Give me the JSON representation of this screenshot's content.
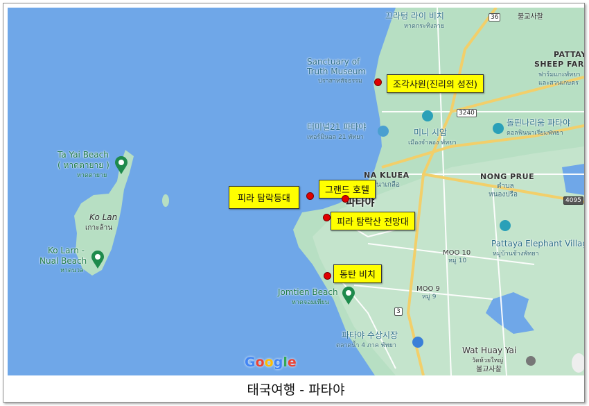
{
  "caption": "태국여행  -  파타야",
  "map": {
    "places": {
      "kradang_beach": "끄라텅 라이 비치",
      "kradang_beach_th": "หาดกระทิงลาย",
      "temple_top": "불교사찰",
      "sanctuary_l1": "Sanctuary of",
      "sanctuary_l2": "Truth Museum",
      "sanctuary_th": "ปราสาทสัจธรรม",
      "pattaya_sheep_l1": "PATTAYA",
      "pattaya_sheep_l2": "SHEEP FARM",
      "pattaya_sheep_th1": "ฟาร์มแกะพัทยา",
      "pattaya_sheep_th2": "และสวนเกษตร",
      "terminal21": "터미널21 파타야",
      "terminal21_th": "เทอร์มินอล 21 พัทยา",
      "mini_siam": "미니 시암",
      "mini_siam_th": "เมืองจำลอง พัทยา",
      "dolphin": "돌핀나리움 파타야",
      "dolphin_th": "ดอลฟินนาเรียมพัทยา",
      "na_kluea": "NA KLUEA",
      "na_kluea_th": "นาเกลือ",
      "nong_prue": "NONG PRUE",
      "nong_prue_th1": "ตำบล",
      "nong_prue_th2": "หนองปรือ",
      "pattaya_city": "파타야",
      "elephant_village": "Pattaya Elephant Villag",
      "elephant_village_th": "หมู่บ้านช้างพัทยา",
      "moo10": "MOO 10",
      "moo10_th": "หมู่ 10",
      "moo9": "MOO 9",
      "moo9_th": "หมู่ 9",
      "jomtien_beach": "Jomtien Beach",
      "jomtien_th": "หาดจอมเทียน",
      "floating_market": "파타야 수상시장",
      "floating_market_th": "ตลาดน้ำ 4 ภาค พัทยา",
      "wat_huay_yai": "Wat Huay Yai",
      "wat_huay_yai_th": "วัดห้วยใหญ่",
      "temple_bottom": "불교사찰",
      "ta_yai_l1": "Ta Yai Beach",
      "ta_yai_l2": "( หาดตายาย )",
      "ta_yai_th": "หาดตายาย",
      "ko_lan": "Ko Lan",
      "ko_lan_th": "เกาะล้าน",
      "ko_larn_l1": "Ko Larn -",
      "ko_larn_l2": "Nual Beach",
      "ko_larn_th": "หาดนวล"
    },
    "roads": {
      "r36": "36",
      "r3240": "3240",
      "r3": "3",
      "r4095": "4095"
    },
    "callouts": {
      "sanctuary": "조각사원(진리의 성전)",
      "grand_hotel": "그랜드 호텔",
      "pattaya_tower": "피라 탐락등대",
      "viewpoint": "피라 탐락산 전망대",
      "dongtan": "동탄 비치"
    },
    "logo": {
      "G": "G",
      "o1": "o",
      "o2": "o",
      "g": "g",
      "l": "l",
      "e": "e"
    },
    "colors": {
      "sea": "#6fa7e8",
      "land": "#b7dfc3",
      "road_major": "#f2cf6a",
      "callout": "#ffff00",
      "marker": "#e00000"
    }
  }
}
